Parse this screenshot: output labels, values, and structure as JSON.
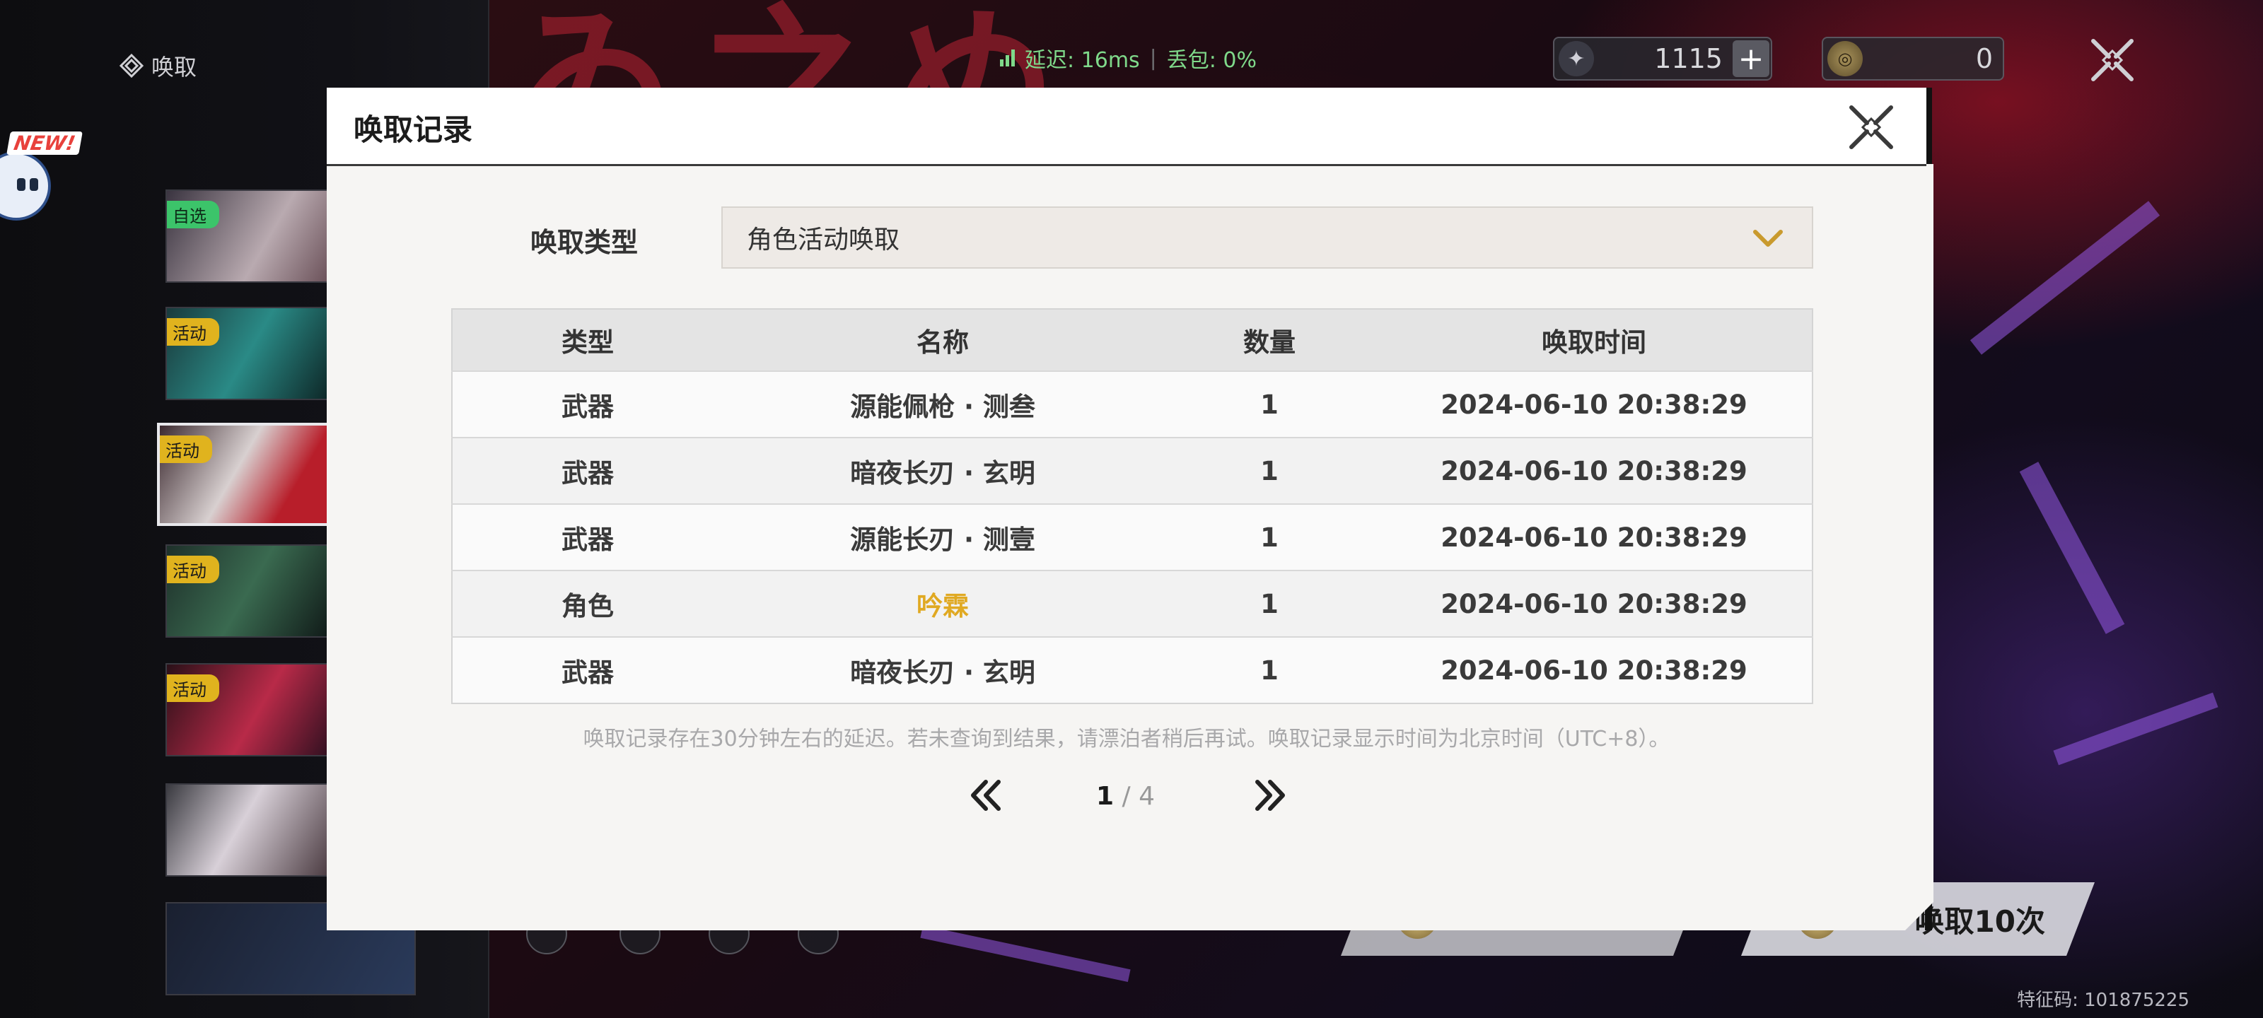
{
  "screen": {
    "title": "唤取",
    "latency_label": "延迟: 16ms",
    "packet_loss_label": "丢包: 0%",
    "currency_a": "1115",
    "currency_b": "0",
    "pull_10_label": "唤取10次",
    "signature": "特征码: 101875225",
    "banner_tags": [
      "自选",
      "活动",
      "活动",
      "活动",
      "活动"
    ],
    "new_label": "NEW!"
  },
  "modal": {
    "title": "唤取记录",
    "type_label": "唤取类型",
    "selected_type": "角色活动唤取",
    "columns": [
      "类型",
      "名称",
      "数量",
      "唤取时间"
    ],
    "rows": [
      {
        "type": "武器",
        "name": "源能佩枪 · 测叁",
        "qty": "1",
        "time": "2024-06-10 20:38:29"
      },
      {
        "type": "武器",
        "name": "暗夜长刃 · 玄明",
        "qty": "1",
        "time": "2024-06-10 20:38:29"
      },
      {
        "type": "武器",
        "name": "源能长刃 · 测壹",
        "qty": "1",
        "time": "2024-06-10 20:38:29"
      },
      {
        "type": "角色",
        "name": "吟霖",
        "qty": "1",
        "time": "2024-06-10 20:38:29"
      },
      {
        "type": "武器",
        "name": "暗夜长刃 · 玄明",
        "qty": "1",
        "time": "2024-06-10 20:38:29"
      }
    ],
    "note": "唤取记录存在30分钟左右的延迟。若未查询到结果，请漂泊者稍后再试。唤取记录显示时间为北京时间（UTC+8）。",
    "page_current": "1",
    "page_total": " / 4",
    "highlight_color": "#e0a922"
  }
}
